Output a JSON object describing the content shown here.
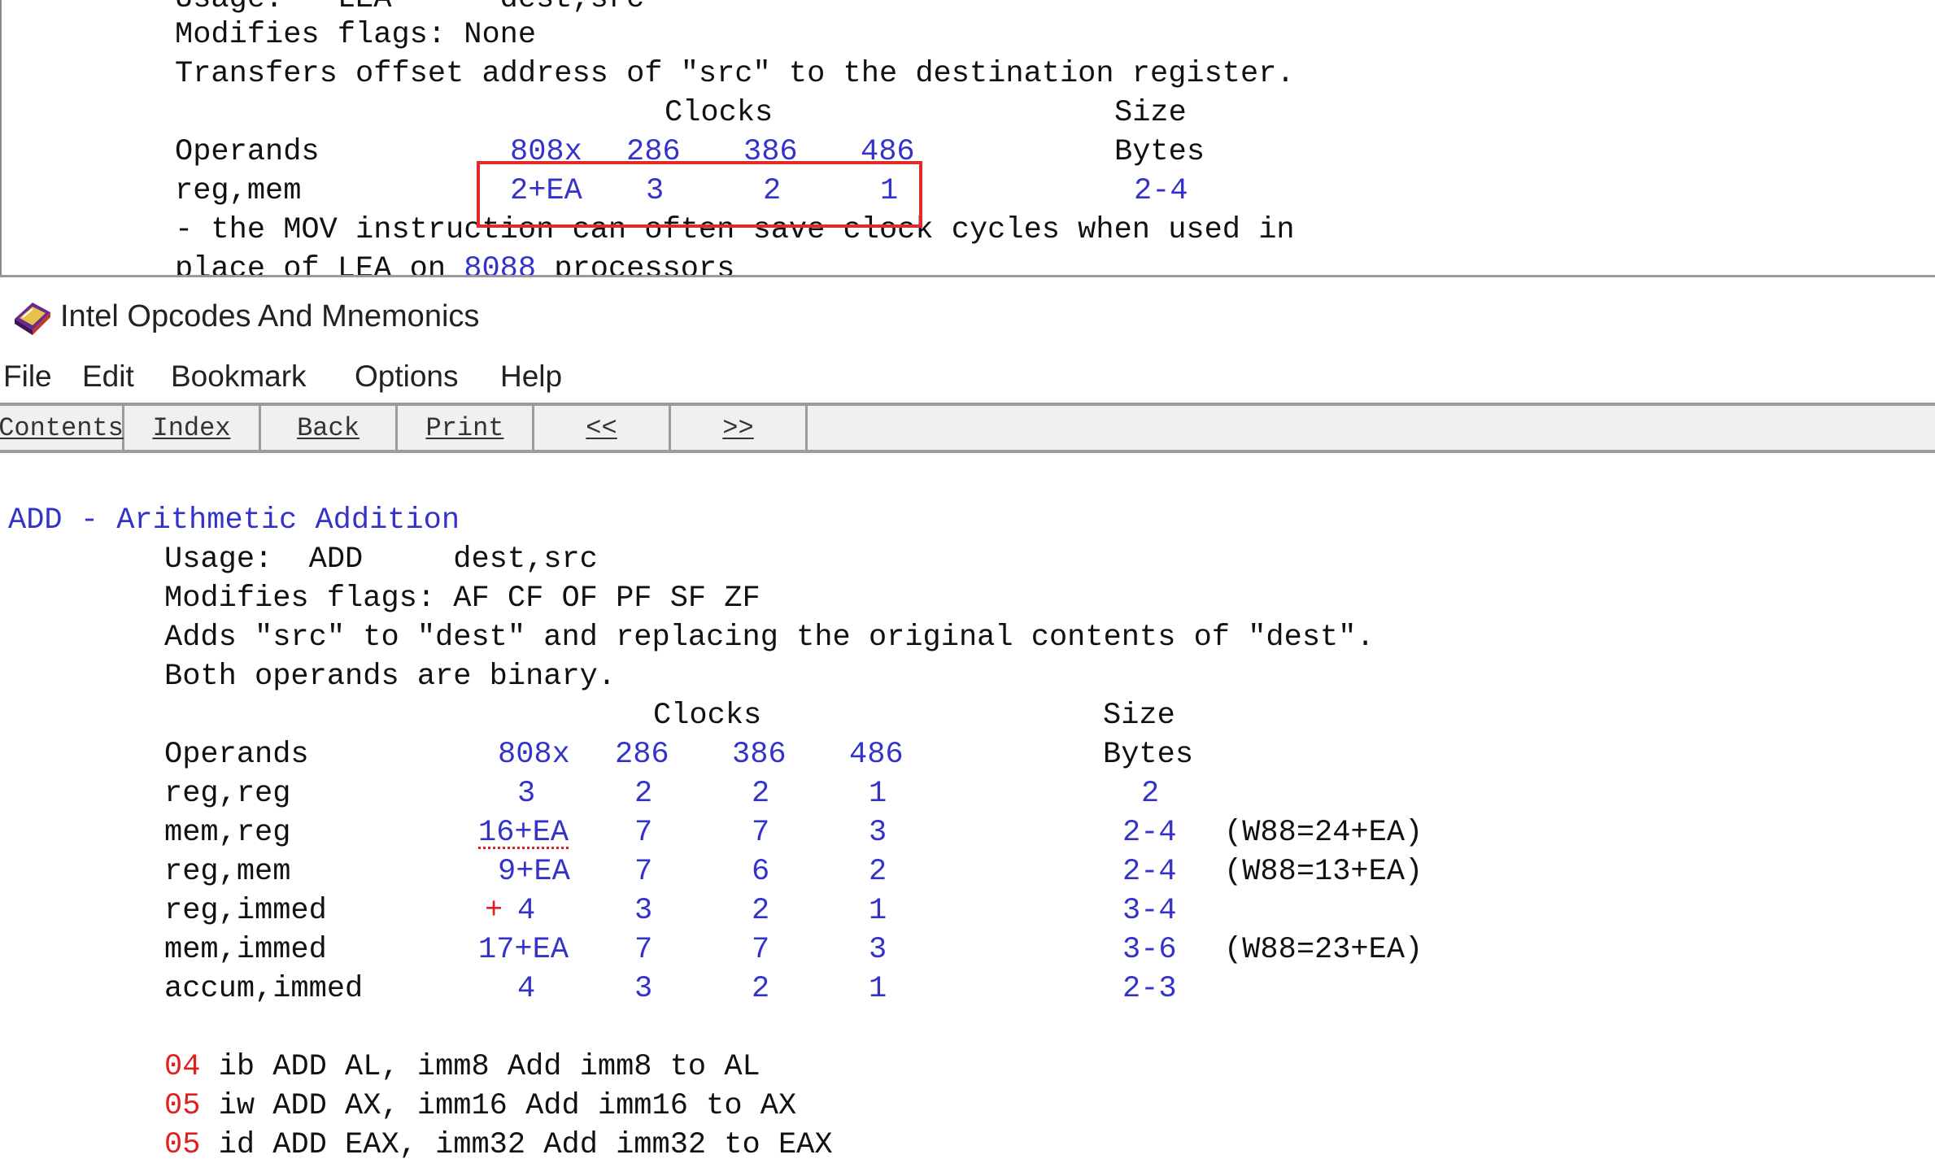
{
  "top_pane": {
    "partial_usage": "Usage:   LEA      dest,src",
    "modifies": "Modifies flags: None",
    "desc": "Transfers offset address of \"src\" to the destination register.",
    "clocks_header": "Clocks",
    "size_header": "Size",
    "operands_header": "Operands",
    "cpus": [
      "808x",
      "286",
      "386",
      "486"
    ],
    "bytes_header": "Bytes",
    "row": {
      "operands": "reg,mem",
      "c808x": "2+EA",
      "c286": "3",
      "c386": "2",
      "c486": "1",
      "bytes": "2-4"
    },
    "note1": "- the MOV instruction can often save clock cycles when used in",
    "note2_pre": "place of LEA on ",
    "note2_link": "8088",
    "note2_post": " processors"
  },
  "window": {
    "title": "Intel Opcodes And Mnemonics"
  },
  "menu": [
    "File",
    "Edit",
    "Bookmark",
    "Options",
    "Help"
  ],
  "toolbar": [
    "Contents",
    "Index",
    "Back",
    "Print",
    "<<",
    ">>"
  ],
  "add": {
    "heading": "ADD - Arithmetic Addition",
    "usage": "Usage:  ADD     dest,src",
    "modifies": "Modifies flags: AF CF OF PF SF ZF",
    "desc1": "Adds \"src\" to \"dest\" and replacing the original contents of \"dest\".",
    "desc2": "Both operands are binary.",
    "clocks_header": "Clocks",
    "size_header": "Size",
    "operands_header": "Operands",
    "cpus": [
      "808x",
      "286",
      "386",
      "486"
    ],
    "bytes_header": "Bytes",
    "rows": [
      {
        "operands": "reg,reg",
        "c808x": "3",
        "c286": "2",
        "c386": "2",
        "c486": "1",
        "bytes": "2",
        "note": ""
      },
      {
        "operands": "mem,reg",
        "c808x": "16+EA",
        "c286": "7",
        "c386": "7",
        "c486": "3",
        "bytes": "2-4",
        "note": "(W88=24+EA)"
      },
      {
        "operands": "reg,mem",
        "c808x": "9+EA",
        "c286": "7",
        "c386": "6",
        "c486": "2",
        "bytes": "2-4",
        "note": "(W88=13+EA)"
      },
      {
        "operands": "reg,immed",
        "c808x": "4",
        "c286": "3",
        "c386": "2",
        "c486": "1",
        "bytes": "3-4",
        "note": ""
      },
      {
        "operands": "mem,immed",
        "c808x": "17+EA",
        "c286": "7",
        "c386": "7",
        "c486": "3",
        "bytes": "3-6",
        "note": "(W88=23+EA)"
      },
      {
        "operands": "accum,immed",
        "c808x": "4",
        "c286": "3",
        "c386": "2",
        "c486": "1",
        "bytes": "2-3",
        "note": ""
      }
    ],
    "plus_mark": "+",
    "opcodes": [
      {
        "code": "04",
        "text": " ib ADD AL, imm8 Add imm8 to AL"
      },
      {
        "code": "05",
        "text": " iw ADD AX, imm16 Add imm16 to AX"
      },
      {
        "code": "05",
        "text": " id ADD EAX, imm32 Add imm32 to EAX"
      }
    ]
  },
  "colors": {
    "link_blue": "#3333cc",
    "opcode_red": "#e02020",
    "highlight_red": "#e02b2b"
  }
}
